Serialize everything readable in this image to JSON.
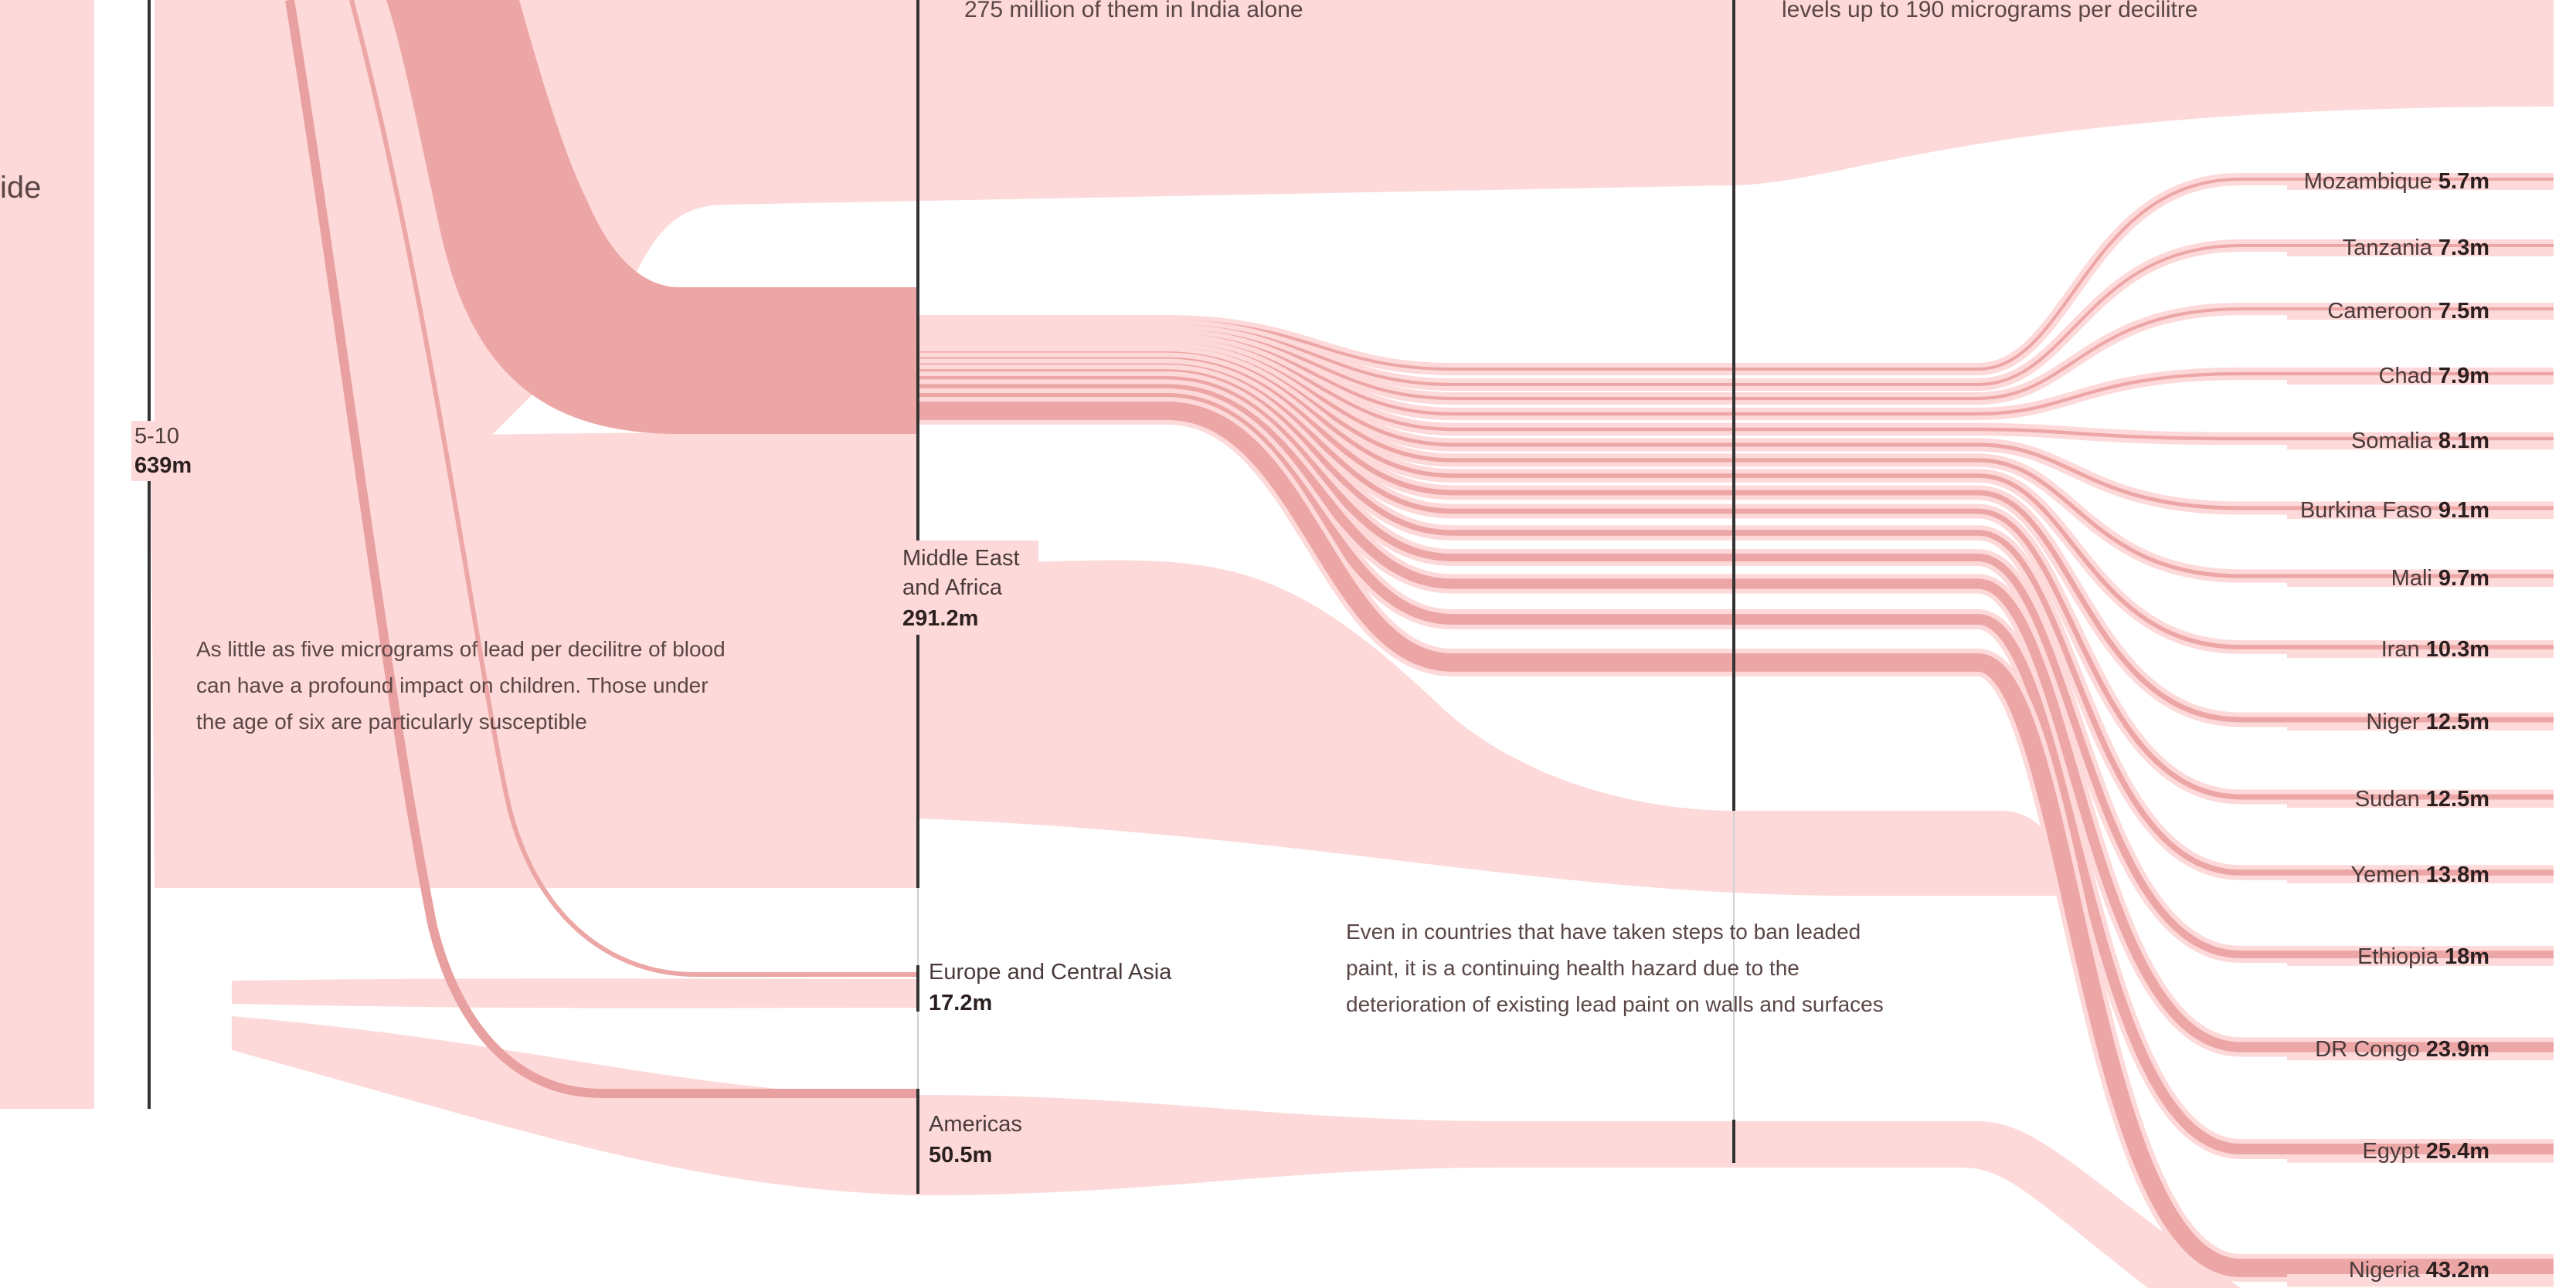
{
  "notes": {
    "top_left": "275 million of them in India alone",
    "top_right": "levels up to 190 micrograms per decilitre",
    "left_edge_fragment": "ide",
    "susceptible": [
      "As little as five micrograms of lead per decilitre of blood",
      "can have a profound impact on children. Those under",
      "the age of six are particularly susceptible"
    ],
    "lead_paint": [
      "Even in countries that have taken steps to ban leaded",
      "paint, it is a continuing health hazard due to the",
      "deterioration of existing lead paint on walls and surfaces"
    ]
  },
  "colors": {
    "flow_light": "#fdd9d9",
    "flow_mid": "#f7c4c4",
    "flow_dark": "#eda6a6",
    "flow_strong": "#e9a0a0",
    "axis": "#333333"
  },
  "chart_data": {
    "type": "sankey",
    "age_group": {
      "label": "5-10",
      "value_label": "639m",
      "value": 639
    },
    "regions": [
      {
        "name_lines": [
          "Middle East",
          "and Africa"
        ],
        "value_label": "291.2m",
        "value": 291.2
      },
      {
        "name_lines": [
          "Europe and Central Asia"
        ],
        "value_label": "17.2m",
        "value": 17.2
      },
      {
        "name_lines": [
          "Americas"
        ],
        "value_label": "50.5m",
        "value": 50.5
      }
    ],
    "countries": [
      {
        "name": "Mozambique",
        "value_label": "5.7m",
        "value": 5.7
      },
      {
        "name": "Tanzania",
        "value_label": "7.3m",
        "value": 7.3
      },
      {
        "name": "Cameroon",
        "value_label": "7.5m",
        "value": 7.5
      },
      {
        "name": "Chad",
        "value_label": "7.9m",
        "value": 7.9
      },
      {
        "name": "Somalia",
        "value_label": "8.1m",
        "value": 8.1
      },
      {
        "name": "Burkina Faso",
        "value_label": "9.1m",
        "value": 9.1
      },
      {
        "name": "Mali",
        "value_label": "9.7m",
        "value": 9.7
      },
      {
        "name": "Iran",
        "value_label": "10.3m",
        "value": 10.3
      },
      {
        "name": "Niger",
        "value_label": "12.5m",
        "value": 12.5
      },
      {
        "name": "Sudan",
        "value_label": "12.5m",
        "value": 12.5
      },
      {
        "name": "Yemen",
        "value_label": "13.8m",
        "value": 13.8
      },
      {
        "name": "Ethiopia",
        "value_label": "18m",
        "value": 18.0
      },
      {
        "name": "DR Congo",
        "value_label": "23.9m",
        "value": 23.9
      },
      {
        "name": "Egypt",
        "value_label": "25.4m",
        "value": 25.4
      },
      {
        "name": "Nigeria",
        "value_label": "43.2m",
        "value": 43.2
      }
    ]
  }
}
